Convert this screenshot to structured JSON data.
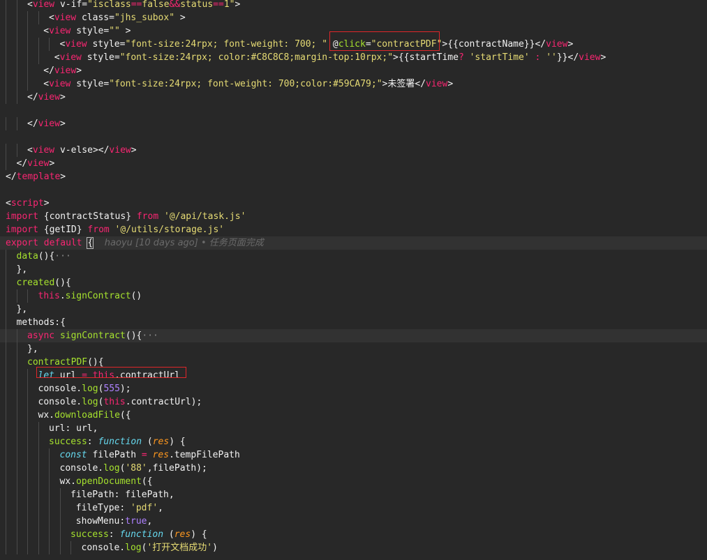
{
  "colors": {
    "background": "#282828",
    "current_line": "#323232",
    "tag": "#f92672",
    "text": "#f2f2f2",
    "string": "#e6db74",
    "keyword": "#f92672",
    "function": "#a6e22e",
    "italic_type": "#66d9ef",
    "param": "#fd971f",
    "number": "#ae81ff",
    "this": "#f92672",
    "blame": "#6a6a6a",
    "annotation_box": "#e0262a"
  },
  "blame_annotation": "haoyu [10 days ago] • 任务页面完成",
  "lines": [
    {
      "indent": 2,
      "tokens": [
        [
          "p",
          "<"
        ],
        [
          "t",
          "view"
        ],
        [
          "x",
          " v-if="
        ],
        [
          "s",
          "\"isclass"
        ],
        [
          "t",
          "=="
        ],
        [
          "s",
          "false"
        ],
        [
          "t",
          "&&"
        ],
        [
          "s",
          "status"
        ],
        [
          "t",
          "=="
        ],
        [
          "s",
          "1\""
        ],
        [
          "p",
          ">"
        ]
      ]
    },
    {
      "indent": 4,
      "tokens": [
        [
          "p",
          "<"
        ],
        [
          "t",
          "view"
        ],
        [
          "x",
          " class="
        ],
        [
          "s",
          "\"jhs_subox\""
        ],
        [
          "p",
          " >"
        ]
      ]
    },
    {
      "indent": 3.5,
      "tokens": [
        [
          "p",
          "<"
        ],
        [
          "t",
          "view"
        ],
        [
          "x",
          " style="
        ],
        [
          "s",
          "\"\""
        ],
        [
          "p",
          " >"
        ]
      ]
    },
    {
      "indent": 5,
      "tokens": [
        [
          "p",
          "<"
        ],
        [
          "t",
          "view"
        ],
        [
          "x",
          " style="
        ],
        [
          "s",
          "\"font-size:24rpx; font-weight: 700; \""
        ],
        [
          "x",
          " "
        ],
        [
          "a",
          "@"
        ],
        [
          "f",
          "click"
        ],
        [
          "x",
          "="
        ],
        [
          "s",
          "\"contractPDF\""
        ],
        [
          "p",
          ">"
        ],
        [
          "x",
          "{{contractName}}"
        ],
        [
          "p",
          "</"
        ],
        [
          "t",
          "view"
        ],
        [
          "p",
          ">"
        ]
      ]
    },
    {
      "indent": 4.5,
      "tokens": [
        [
          "p",
          "<"
        ],
        [
          "t",
          "view"
        ],
        [
          "x",
          " style="
        ],
        [
          "s",
          "\"font-size:24rpx; color:#C8C8C8;margin-top:10rpx;\""
        ],
        [
          "p",
          ">"
        ],
        [
          "x",
          "{{startTime"
        ],
        [
          "t",
          "?"
        ],
        [
          "s",
          " 'startTime'"
        ],
        [
          "t",
          " : "
        ],
        [
          "s",
          "''"
        ],
        [
          "x",
          "}}"
        ],
        [
          "p",
          "</"
        ],
        [
          "t",
          "view"
        ],
        [
          "p",
          ">"
        ]
      ]
    },
    {
      "indent": 3.5,
      "tokens": [
        [
          "p",
          "</"
        ],
        [
          "t",
          "view"
        ],
        [
          "p",
          ">"
        ]
      ]
    },
    {
      "indent": 3.5,
      "tokens": [
        [
          "p",
          "<"
        ],
        [
          "t",
          "view"
        ],
        [
          "x",
          " style="
        ],
        [
          "s",
          "\"font-size:24rpx; font-weight: 700;color:#59CA79;\""
        ],
        [
          "p",
          ">"
        ],
        [
          "x",
          "未签署"
        ],
        [
          "p",
          "</"
        ],
        [
          "t",
          "view"
        ],
        [
          "p",
          ">"
        ]
      ]
    },
    {
      "indent": 2,
      "tokens": [
        [
          "p",
          "</"
        ],
        [
          "t",
          "view"
        ],
        [
          "p",
          ">"
        ]
      ]
    },
    {
      "indent": 0,
      "tokens": []
    },
    {
      "indent": 2,
      "tokens": [
        [
          "p",
          "</"
        ],
        [
          "t",
          "view"
        ],
        [
          "p",
          ">"
        ]
      ]
    },
    {
      "indent": 0,
      "tokens": []
    },
    {
      "indent": 2,
      "tokens": [
        [
          "p",
          "<"
        ],
        [
          "t",
          "view"
        ],
        [
          "x",
          " v-else"
        ],
        [
          "p",
          ">"
        ],
        [
          "p",
          "</"
        ],
        [
          "t",
          "view"
        ],
        [
          "p",
          ">"
        ]
      ]
    },
    {
      "indent": 1,
      "tokens": [
        [
          "p",
          "</"
        ],
        [
          "t",
          "view"
        ],
        [
          "p",
          ">"
        ]
      ]
    },
    {
      "indent": 0,
      "tokens": [
        [
          "p",
          "</"
        ],
        [
          "t",
          "template"
        ],
        [
          "p",
          ">"
        ]
      ]
    },
    {
      "indent": 0,
      "tokens": []
    },
    {
      "indent": 0,
      "tokens": [
        [
          "p",
          "<"
        ],
        [
          "t",
          "script"
        ],
        [
          "p",
          ">"
        ]
      ]
    },
    {
      "indent": 0,
      "tokens": [
        [
          "k",
          "import"
        ],
        [
          "x",
          " {contractStatus} "
        ],
        [
          "k",
          "from"
        ],
        [
          "s",
          " '@/api/task.js'"
        ]
      ]
    },
    {
      "indent": 0,
      "tokens": [
        [
          "k",
          "import"
        ],
        [
          "x",
          " {getID} "
        ],
        [
          "k",
          "from"
        ],
        [
          "s",
          " '@/utils/storage.js'"
        ]
      ]
    },
    {
      "indent": 0,
      "hl": true,
      "tokens": [
        [
          "k",
          "export"
        ],
        [
          "x",
          " "
        ],
        [
          "k",
          "default"
        ],
        [
          "x",
          " "
        ],
        [
          "b",
          "{"
        ]
      ],
      "blame": true
    },
    {
      "indent": 1,
      "tokens": [
        [
          "fw",
          "data"
        ],
        [
          "x",
          "(){"
        ],
        [
          "e",
          "···"
        ]
      ]
    },
    {
      "indent": 1,
      "tokens": [
        [
          "x",
          "},"
        ]
      ]
    },
    {
      "indent": 1,
      "tokens": [
        [
          "fw",
          "created"
        ],
        [
          "x",
          "(){"
        ]
      ]
    },
    {
      "indent": 3,
      "tokens": [
        [
          "th",
          "this"
        ],
        [
          "x",
          "."
        ],
        [
          "f",
          "signContract"
        ],
        [
          "x",
          "()"
        ]
      ]
    },
    {
      "indent": 1,
      "tokens": [
        [
          "x",
          "},"
        ]
      ]
    },
    {
      "indent": 1,
      "tokens": [
        [
          "x",
          "methods:{"
        ]
      ]
    },
    {
      "indent": 2,
      "hl": true,
      "tokens": [
        [
          "k",
          "async"
        ],
        [
          "x",
          " "
        ],
        [
          "f",
          "signContract"
        ],
        [
          "x",
          "(){"
        ],
        [
          "e",
          "···"
        ]
      ]
    },
    {
      "indent": 2,
      "tokens": [
        [
          "x",
          "},"
        ]
      ]
    },
    {
      "indent": 2,
      "tokens": [
        [
          "f",
          "contractPDF"
        ],
        [
          "x",
          "(){"
        ]
      ]
    },
    {
      "indent": 3,
      "tokens": [
        [
          "it",
          "let"
        ],
        [
          "x",
          " url "
        ],
        [
          "k",
          "="
        ],
        [
          "x",
          " "
        ],
        [
          "th",
          "this"
        ],
        [
          "x",
          ".contractUrl"
        ]
      ]
    },
    {
      "indent": 3,
      "tokens": [
        [
          "x",
          "console."
        ],
        [
          "f",
          "log"
        ],
        [
          "x",
          "("
        ],
        [
          "n",
          "555"
        ],
        [
          "x",
          ");"
        ]
      ]
    },
    {
      "indent": 3,
      "tokens": [
        [
          "x",
          "console."
        ],
        [
          "f",
          "log"
        ],
        [
          "x",
          "("
        ],
        [
          "th",
          "this"
        ],
        [
          "x",
          ".contractUrl);"
        ]
      ]
    },
    {
      "indent": 3,
      "tokens": [
        [
          "x",
          "wx."
        ],
        [
          "f",
          "downloadFile"
        ],
        [
          "x",
          "({"
        ]
      ]
    },
    {
      "indent": 4,
      "tokens": [
        [
          "x",
          "url: url,"
        ]
      ]
    },
    {
      "indent": 4,
      "tokens": [
        [
          "f",
          "success"
        ],
        [
          "x",
          ": "
        ],
        [
          "it",
          "function"
        ],
        [
          "x",
          " ("
        ],
        [
          "pa",
          "res"
        ],
        [
          "x",
          ") {"
        ]
      ]
    },
    {
      "indent": 5,
      "tokens": [
        [
          "it",
          "const"
        ],
        [
          "x",
          " filePath "
        ],
        [
          "k",
          "="
        ],
        [
          "x",
          " "
        ],
        [
          "pa",
          "res"
        ],
        [
          "x",
          ".tempFilePath"
        ]
      ]
    },
    {
      "indent": 5,
      "tokens": [
        [
          "x",
          "console."
        ],
        [
          "f",
          "log"
        ],
        [
          "x",
          "("
        ],
        [
          "s",
          "'88'"
        ],
        [
          "x",
          ",filePath);"
        ]
      ]
    },
    {
      "indent": 5,
      "tokens": [
        [
          "x",
          "wx."
        ],
        [
          "f",
          "openDocument"
        ],
        [
          "x",
          "({"
        ]
      ]
    },
    {
      "indent": 6,
      "tokens": [
        [
          "x",
          "filePath: filePath,"
        ]
      ]
    },
    {
      "indent": 6.5,
      "tokens": [
        [
          "x",
          "fileType: "
        ],
        [
          "s",
          "'pdf'"
        ],
        [
          "x",
          ","
        ]
      ]
    },
    {
      "indent": 6.5,
      "tokens": [
        [
          "x",
          "showMenu:"
        ],
        [
          "n",
          "true"
        ],
        [
          "x",
          ","
        ]
      ]
    },
    {
      "indent": 6,
      "tokens": [
        [
          "f",
          "success"
        ],
        [
          "x",
          ": "
        ],
        [
          "it",
          "function"
        ],
        [
          "x",
          " ("
        ],
        [
          "pa",
          "res"
        ],
        [
          "x",
          ") {"
        ]
      ]
    },
    {
      "indent": 7,
      "tokens": [
        [
          "x",
          "console."
        ],
        [
          "f",
          "log"
        ],
        [
          "x",
          "("
        ],
        [
          "s",
          "'打开文档成功'"
        ],
        [
          "x",
          ")"
        ]
      ]
    }
  ]
}
